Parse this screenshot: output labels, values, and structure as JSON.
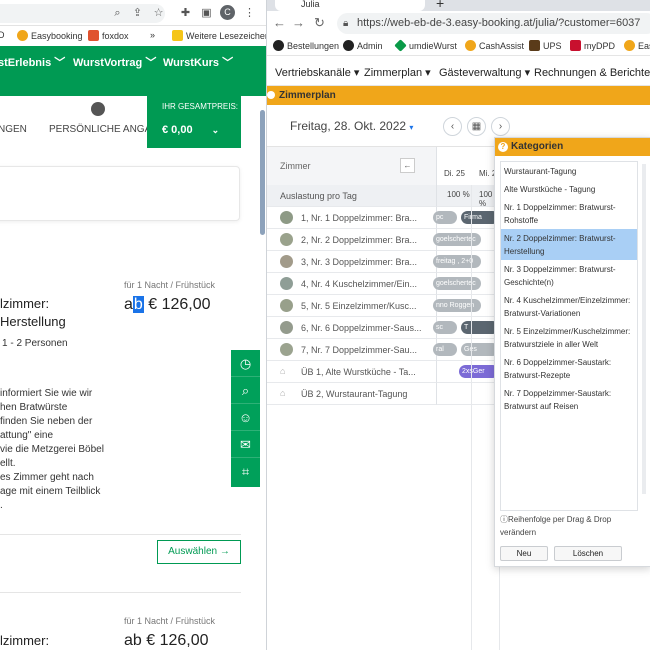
{
  "left_window": {
    "bookmarks": [
      {
        "label": "D",
        "color": "#f0a61a"
      },
      {
        "label": "Easybooking",
        "color": "#f0a61a"
      },
      {
        "label": "foxdox",
        "color": "#e0532f"
      },
      {
        "label": "»",
        "color": ""
      },
      {
        "label": "Weitere Lesezeichen",
        "color": "#f5c518"
      }
    ],
    "nav_items": [
      "stErlebnis",
      "WurstVortrag",
      "WurstKurs"
    ],
    "steps": [
      "NGEN",
      "PERSÖNLICHE ANGABEN"
    ],
    "gesamtpreis_label": "IHR GESAMTPREIS:",
    "gesamtpreis_value": "€ 0,00",
    "room1": {
      "title_line1": "lzimmer:",
      "title_line2": "Herstellung",
      "persons": "1 - 2 Personen",
      "price_label": "für 1 Nacht / Frühstück",
      "price_sel": "b",
      "price_pre": "a",
      "price_rest": "€ 126,00",
      "description": [
        "informiert Sie wie wir",
        "hen Bratwürste",
        "finden Sie neben der",
        "attung\" eine",
        "vie die Metzgerei Böbel",
        "ellt.",
        "es Zimmer geht nach",
        "age mit einem Teilblick",
        "."
      ],
      "button": "Auswählen →"
    },
    "room2": {
      "title_line1": "lzimmer:",
      "price_label": "für 1 Nacht / Frühstück",
      "price": "ab € 126,00"
    },
    "float_icons": [
      "clock-icon",
      "search-icon",
      "user-icon",
      "mail-icon",
      "crop-icon"
    ]
  },
  "right_window": {
    "tab_title": "Julia",
    "url": "https://web-eb-de-3.easy-booking.at/julia/?customer=6037",
    "bookmarks": [
      "Bestellungen",
      "Admin",
      "umdieWurst",
      "CashAssist",
      "UPS",
      "myDPD",
      "Eas"
    ],
    "menu": [
      "Vertriebskanäle ▾",
      "Zimmerplan ▾",
      "Gästeverwaltung ▾",
      "Rechnungen & Berichte ▾"
    ],
    "section_title": "Zimmerplan",
    "date": "Freitag, 28. Okt. 2022",
    "room_header": "Zimmer",
    "collapse_icon": "←",
    "days": [
      "Di. 25",
      "Mi. 2"
    ],
    "auslastung_label": "Auslastung pro Tag",
    "auslastung_values": [
      "100 %",
      "100 %"
    ],
    "rooms": [
      {
        "label": "1, Nr. 1 Doppelzimmer: Bra...",
        "pill": "pc",
        "pill2": "Firma",
        "style": "gray",
        "style2": "dark"
      },
      {
        "label": "2, Nr. 2 Doppelzimmer: Bra...",
        "pill": "goelschertec",
        "pill2": "",
        "style": "gray",
        "style2": ""
      },
      {
        "label": "3, Nr. 3 Doppelzimmer: Bra...",
        "pill": "freitag , 2+0",
        "pill2": "",
        "style": "gray",
        "style2": ""
      },
      {
        "label": "4, Nr. 4 Kuschelzimmer/Ein...",
        "pill": "goelschertec",
        "pill2": "",
        "style": "gray",
        "style2": ""
      },
      {
        "label": "5, Nr. 5 Einzelzimmer/Kusc...",
        "pill": "nno Roggen",
        "pill2": "",
        "style": "gray",
        "style2": ""
      },
      {
        "label": "6, Nr. 6 Doppelzimmer-Saus...",
        "pill": "sc",
        "pill2": "T",
        "style": "gray",
        "style2": "dark"
      },
      {
        "label": "7, Nr. 7 Doppelzimmer-Sau...",
        "pill": "ral",
        "pill2": "Ges",
        "style": "gray",
        "style2": "gray"
      },
      {
        "label": "ÜB 1, Alte Wurstküche - Ta...",
        "pill": "2xsGer",
        "pill2": "",
        "style": "purple",
        "style2": ""
      },
      {
        "label": "ÜB 2, Wurstaurant-Tagung",
        "pill": "",
        "pill2": "",
        "style": "",
        "style2": ""
      }
    ],
    "dialog": {
      "title": "Kategorien",
      "items": [
        "Wurstaurant-Tagung",
        "Alte Wurstküche - Tagung",
        "Nr. 1 Doppelzimmer: Bratwurst-Rohstoffe",
        "Nr. 2 Doppelzimmer: Bratwurst-Herstellung",
        "Nr. 3 Doppelzimmer: Bratwurst-Geschichte(n)",
        "Nr. 4 Kuschelzimmer/Einzelzimmer: Bratwurst-Variationen",
        "Nr. 5 Einzelzimmer/Kuschelzimmer: Bratwurstziele in aller Welt",
        "Nr. 6 Doppelzimmer-Saustark: Bratwurst-Rezepte",
        "Nr. 7 Doppelzimmer-Saustark: Bratwurst auf Reisen"
      ],
      "selected_index": 3,
      "note": "ⓘReihenfolge per Drag & Drop verändern",
      "btn_new": "Neu",
      "btn_delete": "Löschen"
    }
  }
}
